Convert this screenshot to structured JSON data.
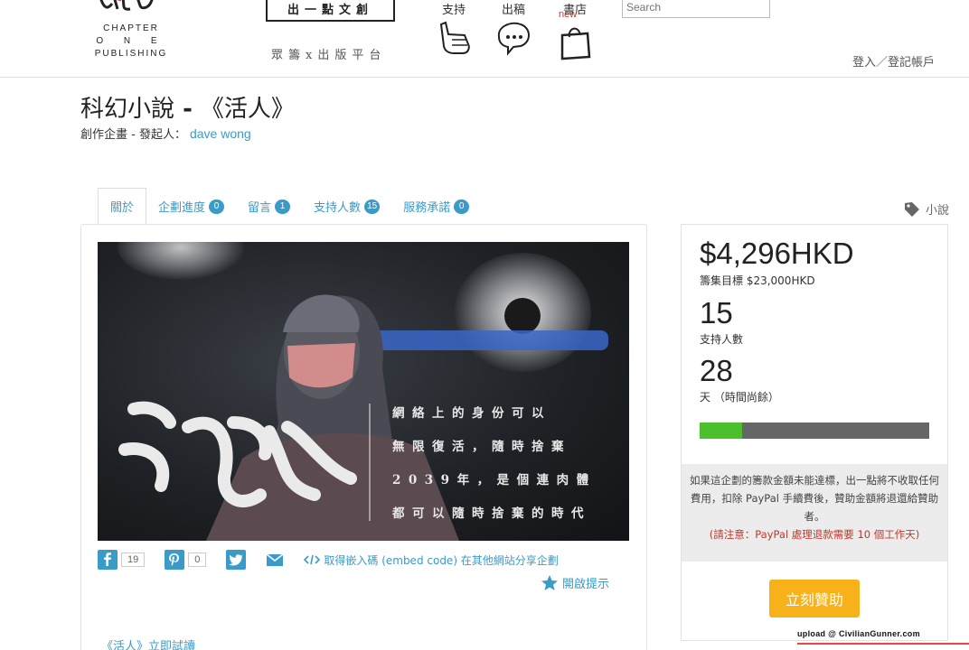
{
  "header": {
    "logo": {
      "line1": "CHAPTER",
      "line2": "O N E",
      "line3": "PUBLISHING"
    },
    "brand_box": "出一點文創",
    "brand_sub": "眾籌x出版平台",
    "nav": [
      {
        "label": "支持",
        "icon": "thumbs-up-icon"
      },
      {
        "label": "出稿",
        "icon": "speech-bubble-icon"
      },
      {
        "label": "書店",
        "icon": "shopping-bag-icon",
        "badge": "new"
      }
    ],
    "search_placeholder": "Search",
    "login": "登入／登記帳戶"
  },
  "project": {
    "title_prefix": "科幻小說",
    "title_dash": " - ",
    "title_name": "《活人》",
    "subtitle_label": "創作企畫 - 發起人：",
    "creator": "dave wong",
    "category": "小說"
  },
  "tabs": [
    {
      "label": "關於"
    },
    {
      "label": "企劃進度",
      "count": "0"
    },
    {
      "label": "留言",
      "count": "1"
    },
    {
      "label": "支持人數",
      "count": "15"
    },
    {
      "label": "服務承諾",
      "count": "0"
    }
  ],
  "hero": {
    "calligraphy": "活人",
    "lines": [
      "網絡上的身份可以",
      "無限復活，隨時捨棄",
      "2039年，是個連肉體",
      "都可以隨時捨棄的時代"
    ]
  },
  "share": {
    "facebook_count": "19",
    "pinterest_count": "0",
    "embed_text": "取得嵌入碼 (embed code) 在其他網站分享企劃",
    "notify": "開啟提示",
    "trial": "《活人》立即試讀"
  },
  "funding": {
    "amount": "$4,296HKD",
    "goal": "籌集目標 $23,000HKD",
    "backers": "15",
    "backers_label": "支持人數",
    "days": "28",
    "days_label": "天 （時間尚餘）",
    "progress": 0.187,
    "colors": {
      "fill": "#4bc02c",
      "track": "#666666",
      "button": "#f7b21a",
      "link": "#3a9bc9"
    },
    "notice": "如果這企劃的籌款金額未能達標，出一點將不收取任何費用，扣除 PayPal 手續費後，贊助金額將退還給贊助者。",
    "warning": "(請注意：PayPal 處理退款需要 10 個工作天)",
    "button": "立刻贊助"
  },
  "watermark": "upload @ CivilianGunner.com"
}
